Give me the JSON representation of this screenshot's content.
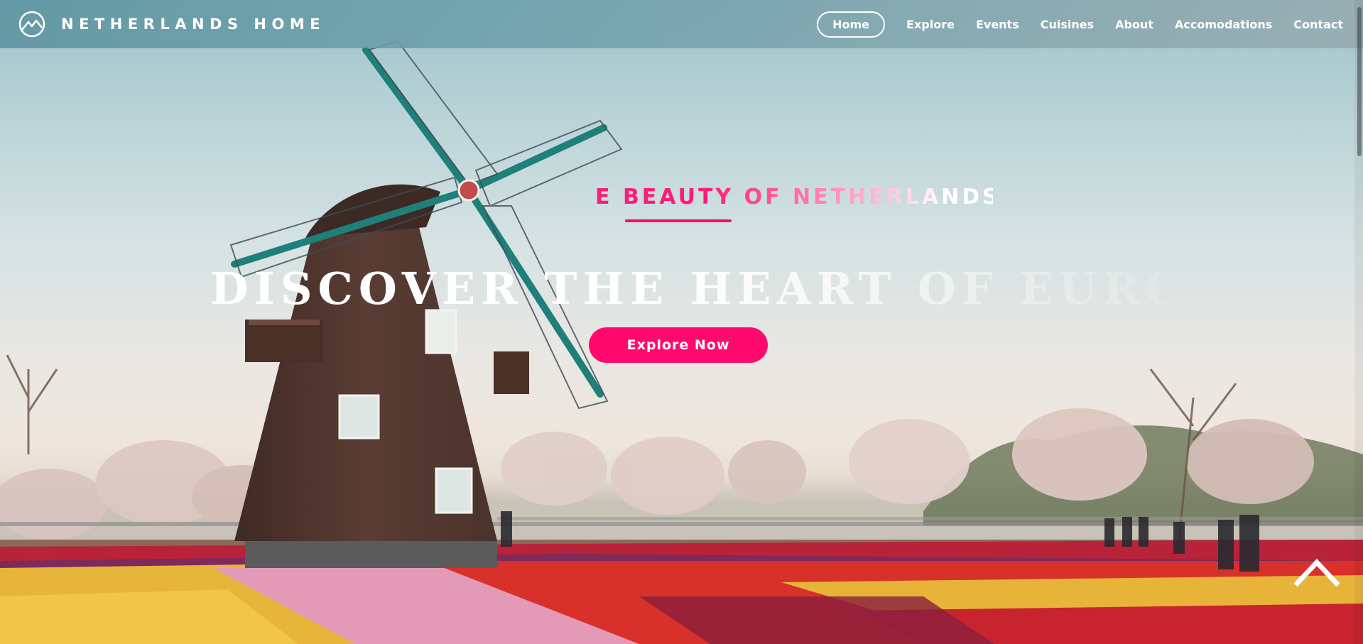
{
  "brand": {
    "name": "NETHERLANDS HOME",
    "logo_icon": "mountain-circle-icon"
  },
  "nav": {
    "items": [
      {
        "label": "Home",
        "active": true
      },
      {
        "label": "Explore",
        "active": false
      },
      {
        "label": "Events",
        "active": false
      },
      {
        "label": "Cuisines",
        "active": false
      },
      {
        "label": "About",
        "active": false
      },
      {
        "label": "Accomodations",
        "active": false
      },
      {
        "label": "Contact",
        "active": false
      }
    ]
  },
  "hero": {
    "subtitle": "E BEAUTY OF NETHERLANDS",
    "headline": "DISCOVER THE HEART OF EUROPE",
    "cta_label": "Explore Now"
  },
  "back_to_top_icon": "chevron-up-icon",
  "colors": {
    "accent": "#ff0a6c",
    "nav_bg": "#6a9ea8",
    "text_light": "#ffffff"
  }
}
